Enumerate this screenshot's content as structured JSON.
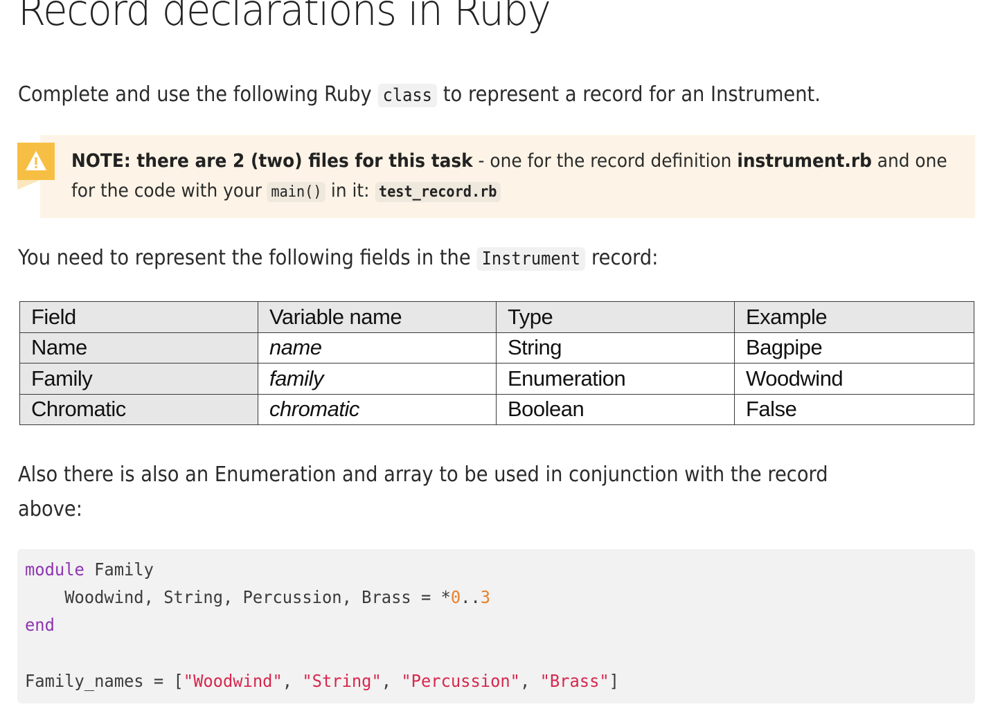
{
  "page_title": "Record declarations in Ruby",
  "intro": {
    "before": "Complete and use the following Ruby ",
    "code": "class",
    "after": " to represent a record for an Instrument."
  },
  "note": {
    "icon": "warning-icon",
    "bold_lead": "NOTE: there are 2 (two) files for this task",
    "text1": " - one for the record definition ",
    "bold_file": "instrument.rb",
    "text2": " and one",
    "line2_before": "for the code with your ",
    "line2_code": "main()",
    "line2_mid": " in it: ",
    "line2_file": "test_record.rb",
    "accent_color": "#f6bf43",
    "background_color": "#fdf4e7"
  },
  "fields_intro": {
    "before": "You need to represent the following fields in the ",
    "code": "Instrument",
    "after": " record:"
  },
  "table": {
    "headers": [
      "Field",
      "Variable name",
      "Type",
      "Example"
    ],
    "rows": [
      [
        "Name",
        "name",
        "String",
        "Bagpipe"
      ],
      [
        "Family",
        "family",
        "Enumeration",
        "Woodwind"
      ],
      [
        "Chromatic",
        "chromatic",
        "Boolean",
        "False"
      ]
    ]
  },
  "enum_intro": {
    "line1": "Also there is also an Enumeration and array to be used in conjunction with the record",
    "line2": "above:"
  },
  "code": {
    "line1_kw": "module",
    "line1_rest": " Family",
    "line2_indent": "    ",
    "line2_text": "Woodwind, String, Percussion, Brass = *",
    "line2_num1": "0",
    "line2_range": "..",
    "line2_num2": "3",
    "line3_kw": "end",
    "line5_prefix": "Family_names = [",
    "line5_strings": [
      "\"Woodwind\"",
      "\"String\"",
      "\"Percussion\"",
      "\"Brass\""
    ],
    "line5_sep": ", ",
    "line5_suffix": "]"
  }
}
